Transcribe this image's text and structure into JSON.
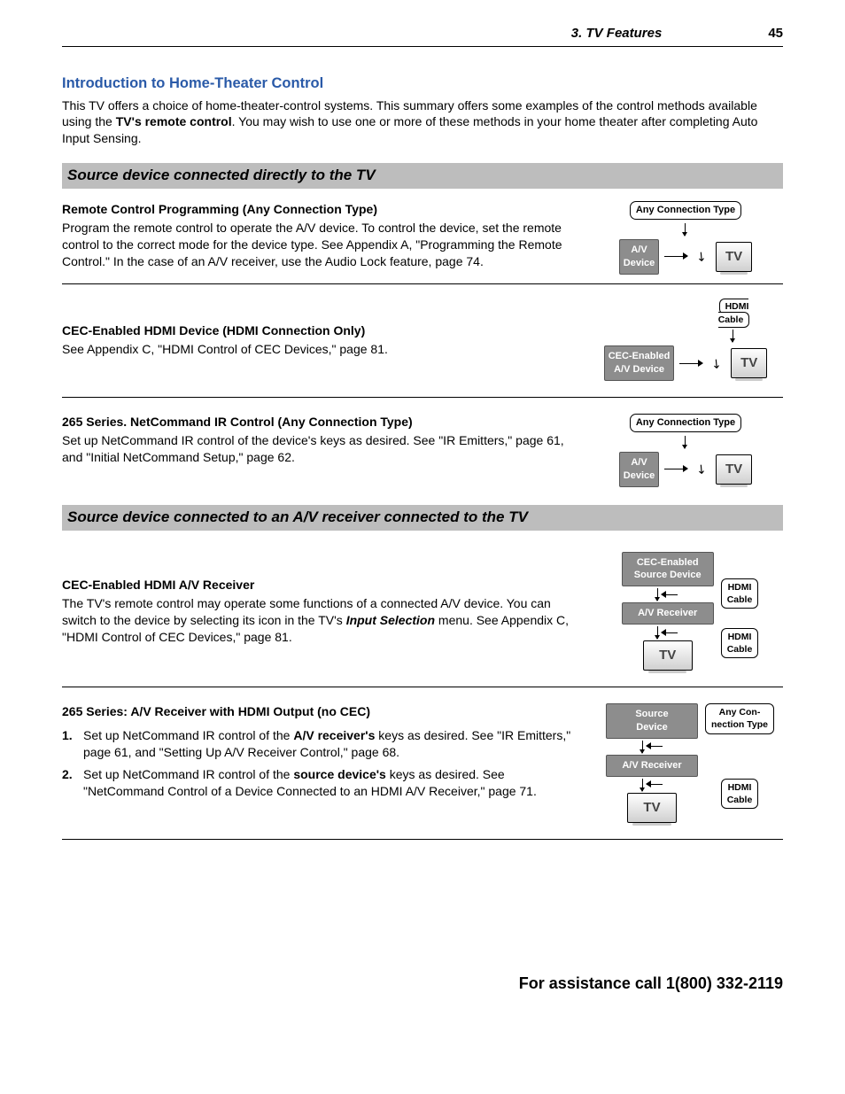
{
  "header": {
    "chapter": "3.  TV Features",
    "page": "45"
  },
  "intro": {
    "heading": "Introduction to Home-Theater Control",
    "p_a": "This TV offers a choice of home-theater-control systems. This summary offers some examples of the control methods available using the ",
    "p_b_bold": "TV's remote control",
    "p_c": ". You may wish to use one or more of these methods in your home theater after completing Auto Input Sensing."
  },
  "band1": "Source device connected directly to the TV",
  "s1a": {
    "title": "Remote Control Programming (Any Connection Type)",
    "text": "Program the remote control to operate the A/V device.  To control the device, set the remote control to the correct mode for the device type.  See  Appendix A, \"Programming the Remote Control.\"  In the case of an A/V receiver, use the Audio Lock feature, page 74.",
    "diag": {
      "top": "Any Connection Type",
      "left": "A/V\nDevice",
      "right": "TV"
    }
  },
  "s1b": {
    "title": "CEC-Enabled HDMI Device (HDMI Connection Only)",
    "text": "See Appendix C, \"HDMI Control of CEC Devices,\" page 81.",
    "diag": {
      "top": "HDMI\nCable",
      "left": "CEC-Enabled\nA/V Device",
      "right": "TV"
    }
  },
  "s1c": {
    "title": "265 Series.  NetCommand IR Control (Any Connection Type)",
    "text": "Set up NetCommand IR control of the device's keys as desired.  See \"IR Emitters,\" page 61, and \"Initial NetCommand Setup,\" page 62.",
    "diag": {
      "top": "Any Connection Type",
      "left": "A/V\nDevice",
      "right": "TV"
    }
  },
  "band2": "Source device connected to an A/V receiver connected to the TV",
  "s2a": {
    "title": "CEC-Enabled HDMI A/V Receiver",
    "t1": "The TV's remote control may operate some functions of a connected A/V device.  You can switch to the device by selecting its icon in the TV's ",
    "t_bold": "Input Selection",
    "t2": " menu.  See Appendix C, \"HDMI Control of CEC Devices,\" page 81.",
    "diag": {
      "src": "CEC-Enabled\nSource Device",
      "cable1": "HDMI\nCable",
      "recv": "A/V Receiver",
      "cable2": "HDMI\nCable",
      "tv": "TV"
    }
  },
  "s2b": {
    "title": "265 Series:  A/V Receiver with HDMI Output (no CEC)",
    "step1a": "Set up NetCommand IR control of the ",
    "step1b": "A/V receiver's",
    "step1c": " keys as desired.  See \"IR Emitters,\" page 61, and \"Setting Up A/V Receiver Control,\" page 68.",
    "step2a": "Set up NetCommand IR control of the ",
    "step2b": "source device's",
    "step2c": " keys as desired.  See \"NetCommand Control of a Device Connected to an HDMI A/V Receiver,\" page 71.",
    "n1": "1.",
    "n2": "2.",
    "diag": {
      "src": "Source\nDevice",
      "conn": "Any Con-\nnection Type",
      "recv": "A/V Receiver",
      "cable2": "HDMI\nCable",
      "tv": "TV"
    }
  },
  "footer": "For assistance call 1(800) 332-2119"
}
